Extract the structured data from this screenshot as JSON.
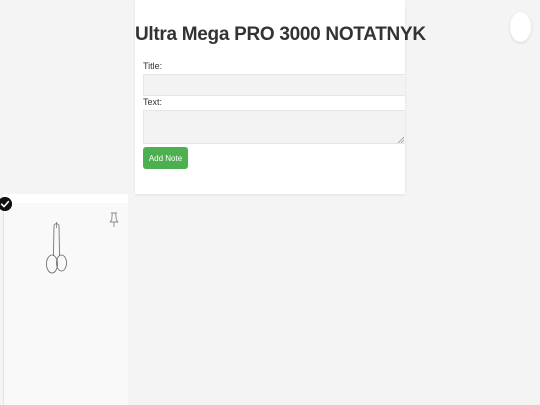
{
  "app": {
    "heading": "Ultra Mega PRO 3000 NOTATNYK"
  },
  "form": {
    "title_label": "Title:",
    "title_value": "",
    "text_label": "Text:",
    "text_value": "",
    "add_button_label": "Add Note"
  },
  "note": {
    "icons": [
      "check-icon",
      "pin-icon",
      "doodle-drawing"
    ]
  },
  "colors": {
    "background": "#f4f4f4",
    "card": "#ffffff",
    "input": "#f3f3f3",
    "accent": "#4caf50"
  }
}
